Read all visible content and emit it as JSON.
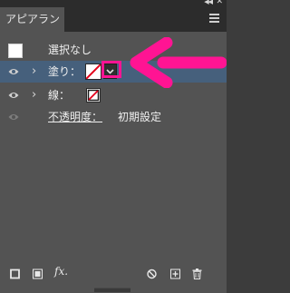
{
  "panel": {
    "tab_title": "アピアランス",
    "no_selection": "選択なし"
  },
  "rows": {
    "fill_label": "塗り：",
    "stroke_label": "線：",
    "opacity_label": "不透明度：",
    "opacity_value": "初期設定"
  },
  "bottom": {
    "fx_label": "fx."
  },
  "colors": {
    "panel_bg": "#535353",
    "selected_row": "#46607c",
    "annotation": "#ff1493"
  }
}
